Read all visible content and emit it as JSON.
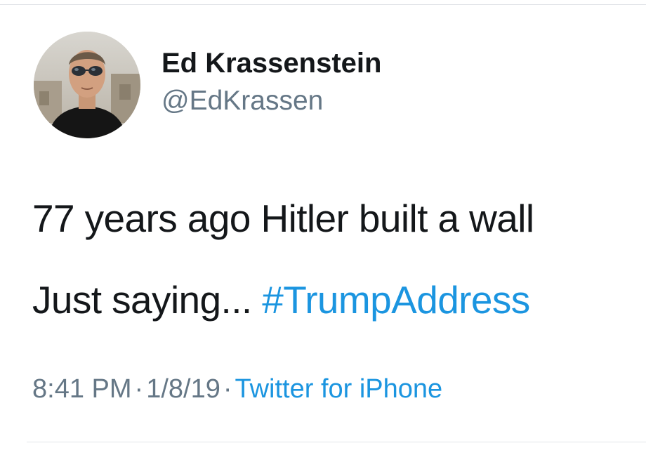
{
  "user": {
    "display_name": "Ed Krassenstein",
    "handle": "@EdKrassen"
  },
  "tweet": {
    "line1": "77 years ago Hitler built a wall",
    "line2_text": "Just saying...",
    "hashtag": "#TrumpAddress"
  },
  "meta": {
    "time": "8:41 PM",
    "separator": "·",
    "date": "1/8/19",
    "source": "Twitter for iPhone"
  },
  "colors": {
    "link": "#1b95e0",
    "secondary_text": "#657786",
    "primary_text": "#14171a"
  }
}
